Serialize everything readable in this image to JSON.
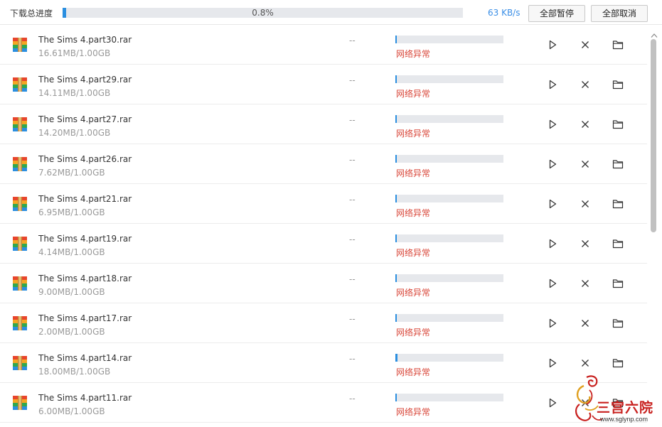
{
  "header": {
    "label": "下载总进度",
    "progress_text": "0.8%",
    "progress_value": 0.008,
    "speed": "63 KB/s",
    "pause_all_label": "全部暂停",
    "cancel_all_label": "全部取消"
  },
  "icons": {
    "file": "winrar-archive-icon",
    "play": "play-icon",
    "close": "close-icon",
    "folder": "folder-icon"
  },
  "colors": {
    "accent": "#2b8fe0",
    "speed": "#3a8ee6",
    "error": "#d9473a"
  },
  "files": [
    {
      "name": "The Sims 4.part30.rar",
      "size": "16.61MB/1.00GB",
      "remaining": "--",
      "progress": 0.016,
      "status": "网络异常"
    },
    {
      "name": "The Sims 4.part29.rar",
      "size": "14.11MB/1.00GB",
      "remaining": "--",
      "progress": 0.014,
      "status": "网络异常"
    },
    {
      "name": "The Sims 4.part27.rar",
      "size": "14.20MB/1.00GB",
      "remaining": "--",
      "progress": 0.014,
      "status": "网络异常"
    },
    {
      "name": "The Sims 4.part26.rar",
      "size": "7.62MB/1.00GB",
      "remaining": "--",
      "progress": 0.007,
      "status": "网络异常"
    },
    {
      "name": "The Sims 4.part21.rar",
      "size": "6.95MB/1.00GB",
      "remaining": "--",
      "progress": 0.007,
      "status": "网络异常"
    },
    {
      "name": "The Sims 4.part19.rar",
      "size": "4.14MB/1.00GB",
      "remaining": "--",
      "progress": 0.004,
      "status": "网络异常"
    },
    {
      "name": "The Sims 4.part18.rar",
      "size": "9.00MB/1.00GB",
      "remaining": "--",
      "progress": 0.009,
      "status": "网络异常"
    },
    {
      "name": "The Sims 4.part17.rar",
      "size": "2.00MB/1.00GB",
      "remaining": "--",
      "progress": 0.002,
      "status": "网络异常"
    },
    {
      "name": "The Sims 4.part14.rar",
      "size": "18.00MB/1.00GB",
      "remaining": "--",
      "progress": 0.018,
      "status": "网络异常"
    },
    {
      "name": "The Sims 4.part11.rar",
      "size": "6.00MB/1.00GB",
      "remaining": "--",
      "progress": 0.006,
      "status": "网络异常"
    }
  ],
  "watermark": {
    "text": "三宫六院",
    "url": "www.sglynp.com"
  }
}
